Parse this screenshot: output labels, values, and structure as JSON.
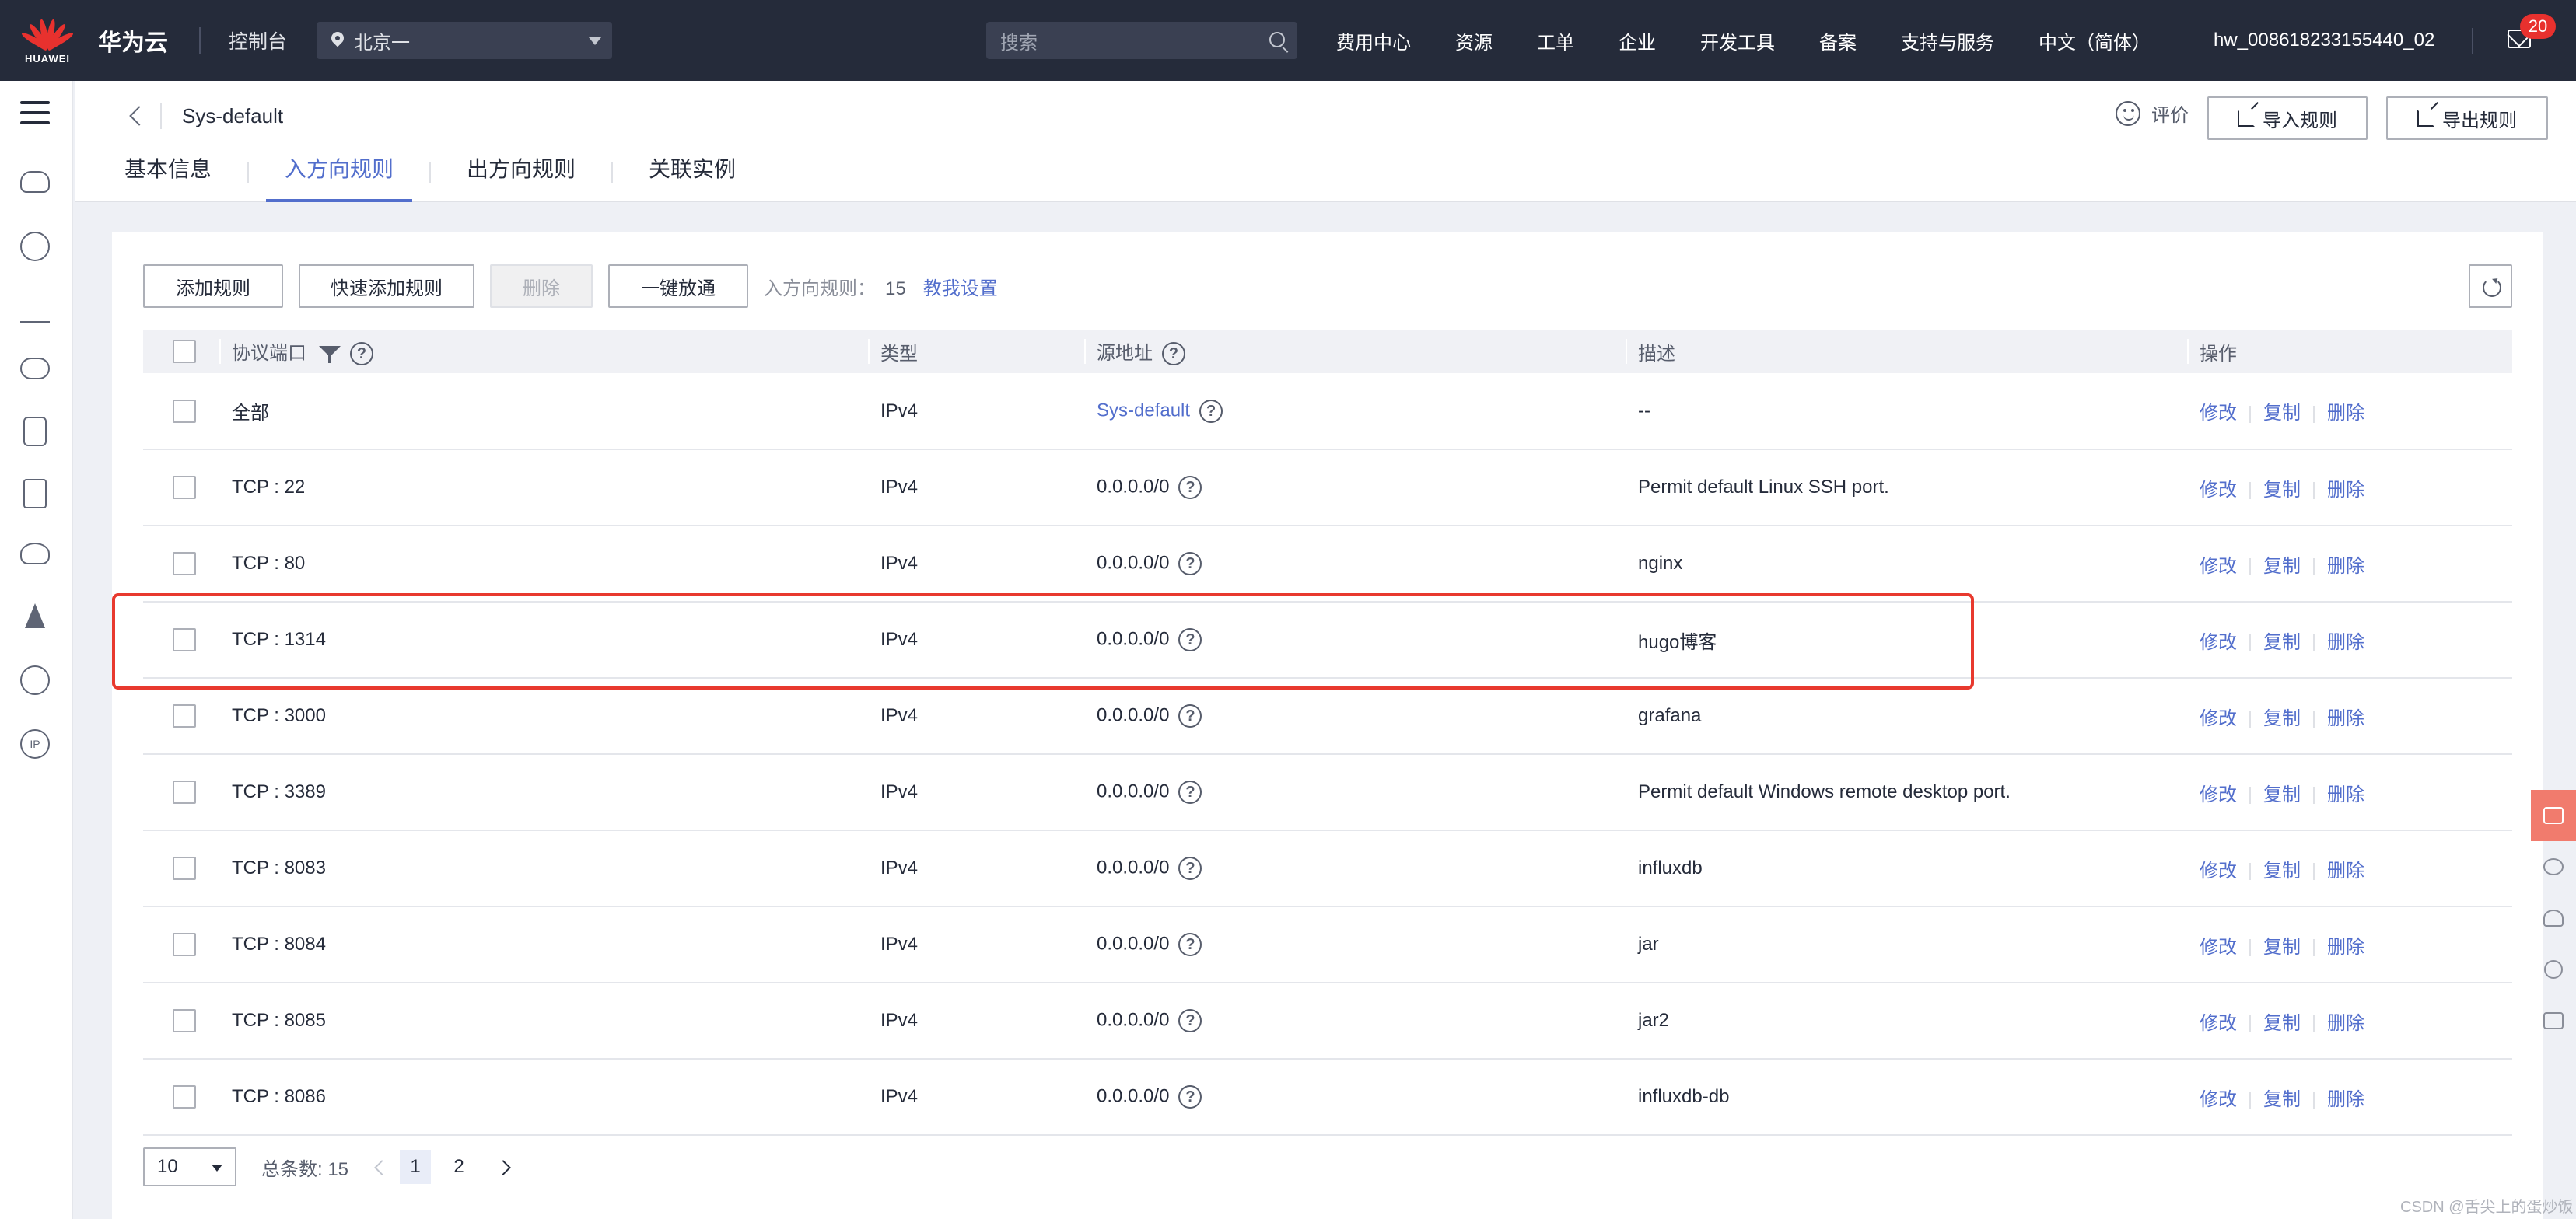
{
  "topbar": {
    "logo_text": "HUAWEI",
    "brand": "华为云",
    "console": "控制台",
    "region": "北京一",
    "search_placeholder": "搜索",
    "nav": [
      "费用中心",
      "资源",
      "工单",
      "企业",
      "开发工具",
      "备案",
      "支持与服务",
      "中文（简体）"
    ],
    "username": "hw_008618233155440_02",
    "mail_badge": "20"
  },
  "header": {
    "sg_name": "Sys-default",
    "rate_label": "评价",
    "import_label": "导入规则",
    "export_label": "导出规则",
    "tabs": [
      {
        "label": "基本信息",
        "active": false
      },
      {
        "label": "入方向规则",
        "active": true
      },
      {
        "label": "出方向规则",
        "active": false
      },
      {
        "label": "关联实例",
        "active": false
      }
    ]
  },
  "toolbar": {
    "add_rule": "添加规则",
    "quick_add": "快速添加规则",
    "delete": "删除",
    "allow_all": "一键放通",
    "rule_count_label": "入方向规则：",
    "rule_count": "15",
    "help_link": "教我设置"
  },
  "table": {
    "columns": [
      "协议端口",
      "类型",
      "源地址",
      "描述",
      "操作"
    ],
    "rows": [
      {
        "port": "全部",
        "type": "IPv4",
        "source": "Sys-default",
        "source_link": true,
        "desc": "--"
      },
      {
        "port": "TCP : 22",
        "type": "IPv4",
        "source": "0.0.0.0/0",
        "source_link": false,
        "desc": "Permit default Linux SSH port."
      },
      {
        "port": "TCP : 80",
        "type": "IPv4",
        "source": "0.0.0.0/0",
        "source_link": false,
        "desc": "nginx"
      },
      {
        "port": "TCP : 1314",
        "type": "IPv4",
        "source": "0.0.0.0/0",
        "source_link": false,
        "desc": "hugo博客"
      },
      {
        "port": "TCP : 3000",
        "type": "IPv4",
        "source": "0.0.0.0/0",
        "source_link": false,
        "desc": "grafana"
      },
      {
        "port": "TCP : 3389",
        "type": "IPv4",
        "source": "0.0.0.0/0",
        "source_link": false,
        "desc": "Permit default Windows remote desktop port."
      },
      {
        "port": "TCP : 8083",
        "type": "IPv4",
        "source": "0.0.0.0/0",
        "source_link": false,
        "desc": "influxdb"
      },
      {
        "port": "TCP : 8084",
        "type": "IPv4",
        "source": "0.0.0.0/0",
        "source_link": false,
        "desc": "jar"
      },
      {
        "port": "TCP : 8085",
        "type": "IPv4",
        "source": "0.0.0.0/0",
        "source_link": false,
        "desc": "jar2"
      },
      {
        "port": "TCP : 8086",
        "type": "IPv4",
        "source": "0.0.0.0/0",
        "source_link": false,
        "desc": "influxdb-db"
      }
    ],
    "ops": [
      "修改",
      "复制",
      "删除"
    ],
    "help_glyph": "?"
  },
  "pagination": {
    "page_size": "10",
    "total_label": "总条数: 15",
    "pages": [
      "1",
      "2"
    ],
    "current": "1"
  },
  "watermark": "CSDN @舌尖上的蛋炒饭",
  "colors": {
    "accent": "#526ecc",
    "topbar": "#252b3a",
    "highlight": "#e8392e"
  }
}
